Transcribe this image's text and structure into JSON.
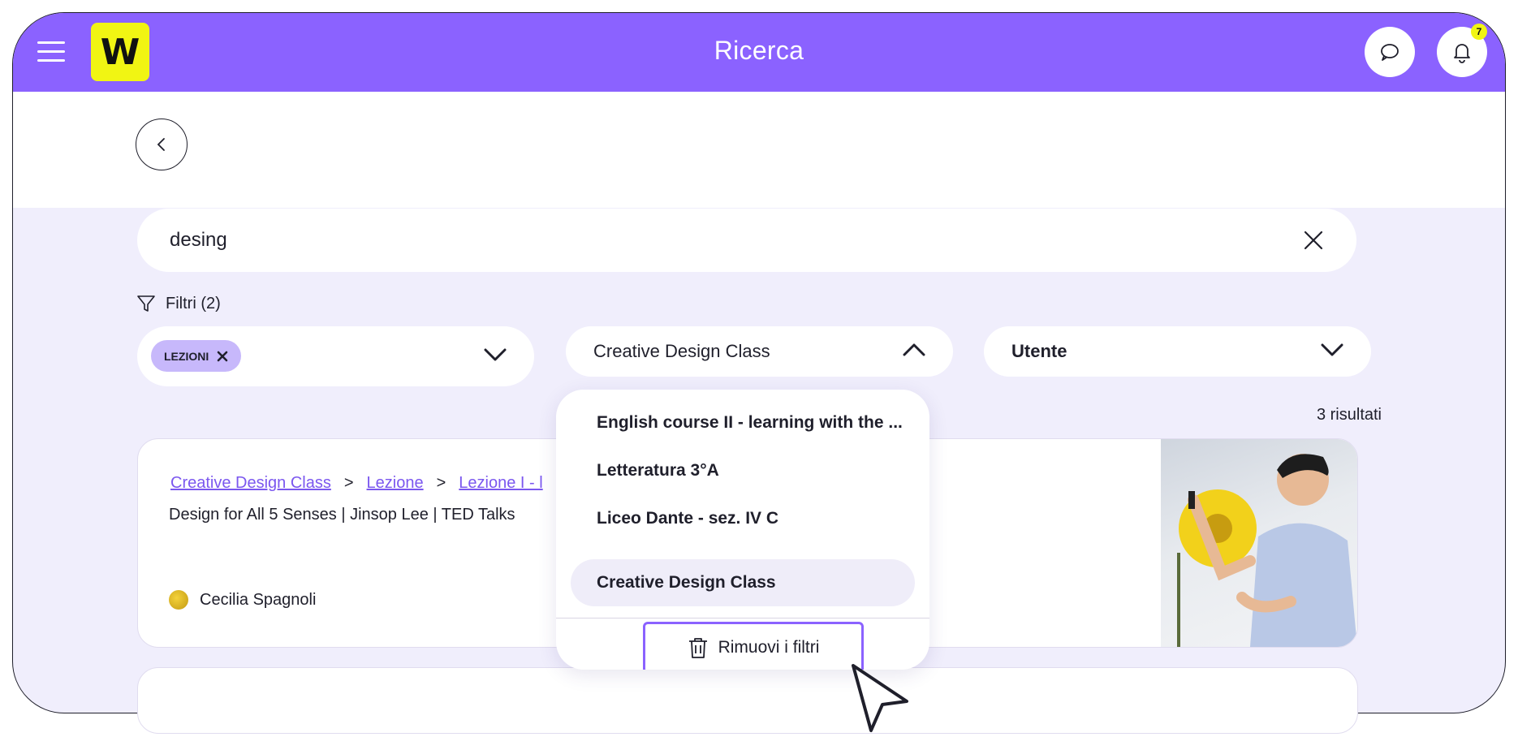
{
  "header": {
    "title": "Ricerca",
    "logo_text": "W",
    "notification_count": "7"
  },
  "search": {
    "value": "desing"
  },
  "filters": {
    "label": "Filtri (2)",
    "type_chip": "LEZIONI",
    "class_selected": "Creative Design Class",
    "user_placeholder": "Utente"
  },
  "dropdown": {
    "options": [
      "English course II - learning with the ...",
      "Letteratura 3°A",
      "Liceo Dante - sez. IV C",
      "Creative Design Class"
    ],
    "active_index": 3,
    "remove_label": "Rimuovi i filtri"
  },
  "results": {
    "count_label": "3 risultati",
    "items": [
      {
        "breadcrumb": [
          "Creative Design Class",
          "Lezione",
          "Lezione I - l"
        ],
        "title": "Design for All 5 Senses | Jinsop Lee | TED Talks",
        "author": "Cecilia Spagnoli"
      }
    ]
  },
  "colors": {
    "brand": "#8b62ff",
    "logo_bg": "#f1f513",
    "chip": "#c7b8fb",
    "page_bg": "#f0eefc"
  },
  "icons": [
    "menu-icon",
    "chat-icon",
    "bell-icon",
    "back-arrow-icon",
    "close-icon",
    "filter-icon",
    "chevron-down-icon",
    "chevron-up-icon",
    "trash-icon",
    "cursor-pointer"
  ]
}
